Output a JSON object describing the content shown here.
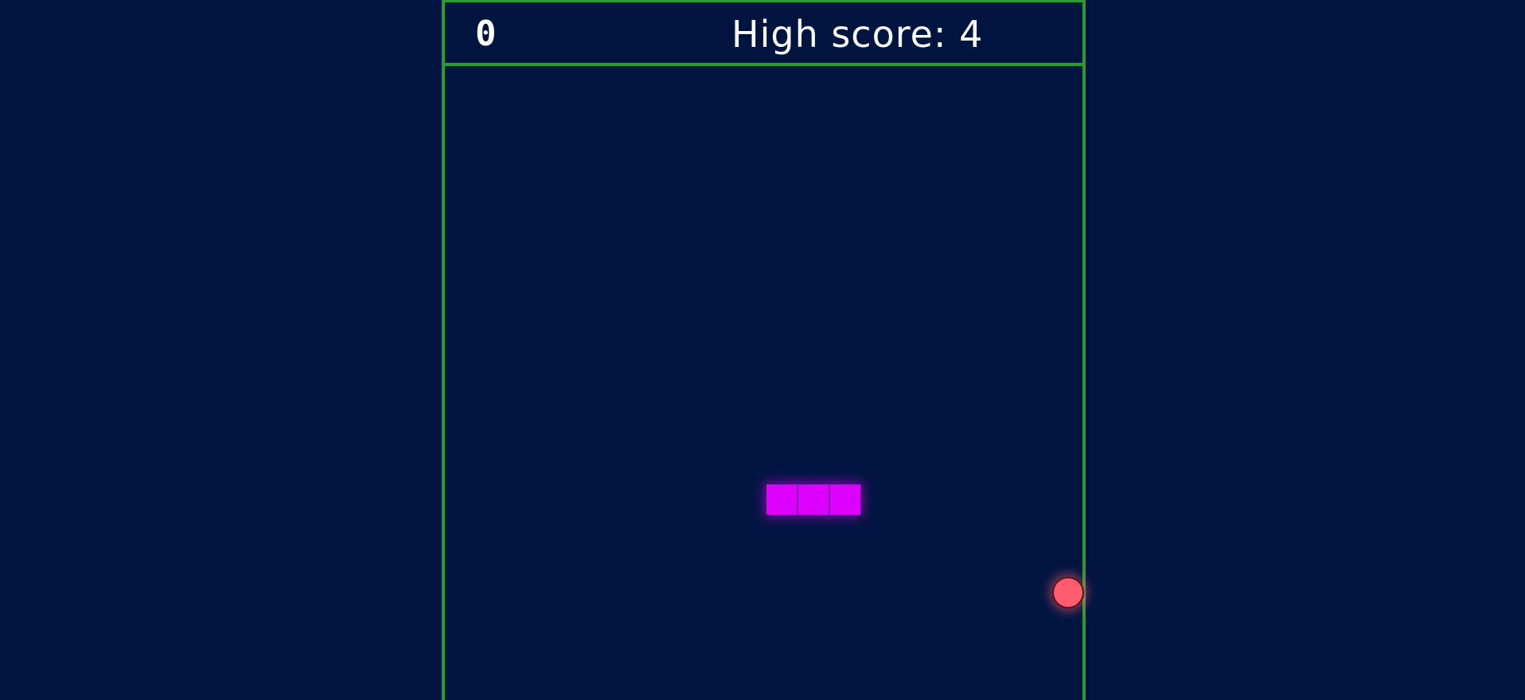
{
  "scoreboard": {
    "score": "0",
    "high_score_label": "High score:",
    "high_score_value": "4"
  },
  "colors": {
    "background": "#001440",
    "border": "#2e9a34",
    "snake": "#dd00ff",
    "food": "#ff5c6e",
    "text": "#ffffff"
  },
  "snake": {
    "segment_count": 3
  }
}
